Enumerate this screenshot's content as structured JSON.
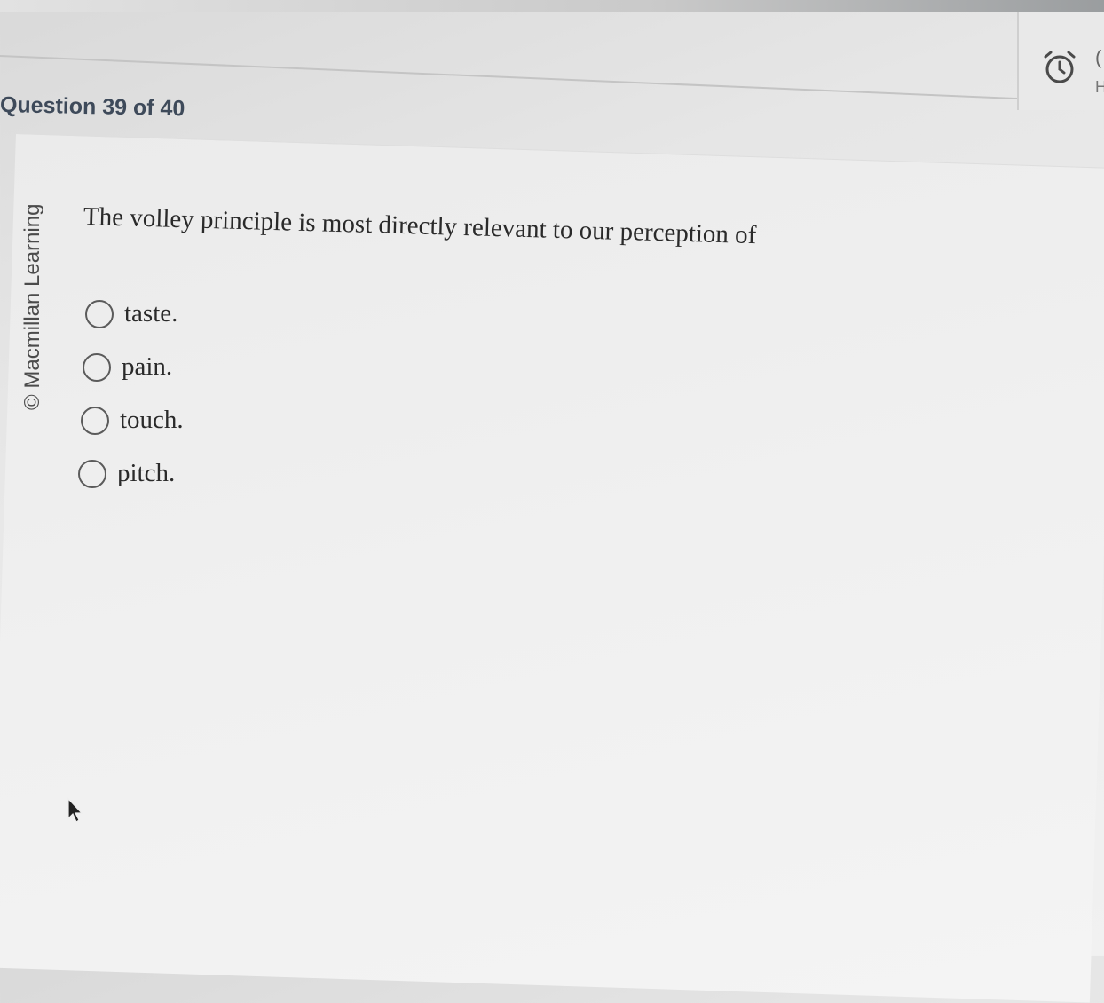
{
  "header": {
    "question_counter": "Question 39 of 40",
    "timer_icon": "alarm-clock-icon",
    "timer_text_line1": "(",
    "timer_text_line2": "H"
  },
  "sidebar": {
    "copyright": "© Macmillan Learning"
  },
  "question": {
    "stem": "The volley principle is most directly relevant to our perception of",
    "options": [
      {
        "label": "taste.",
        "selected": false
      },
      {
        "label": "pain.",
        "selected": false
      },
      {
        "label": "touch.",
        "selected": false
      },
      {
        "label": "pitch.",
        "selected": false
      }
    ]
  },
  "icons": {
    "radio": "radio-button-icon",
    "cursor": "mouse-pointer-icon"
  },
  "colors": {
    "text": "#2a2a2a",
    "counter_text": "#3e4a5a",
    "radio_border": "#5b5b5b",
    "background": "#ececec"
  }
}
